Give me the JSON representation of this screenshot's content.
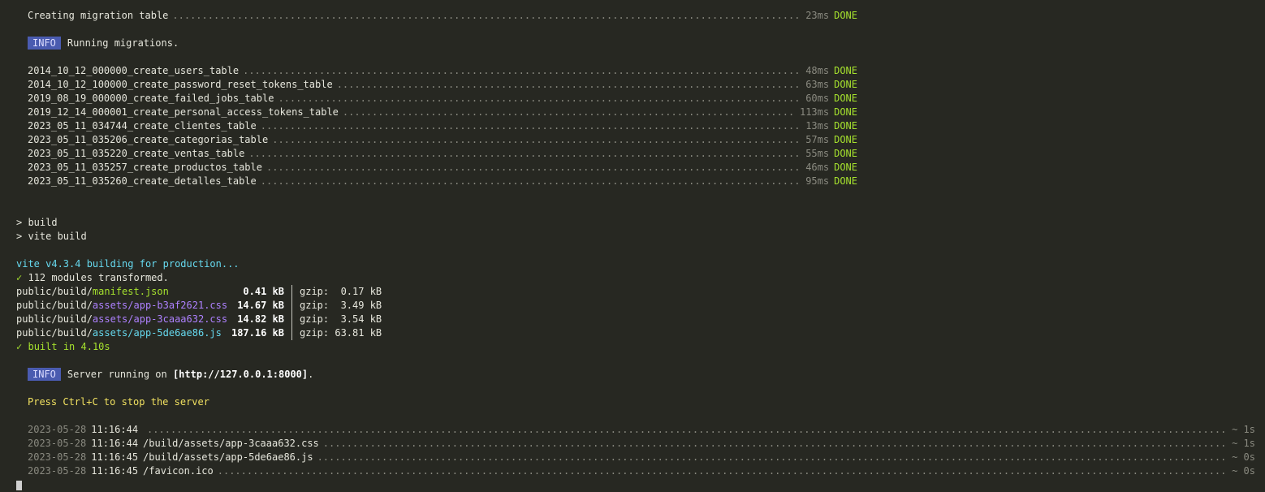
{
  "migration_table": {
    "name": "Creating migration table",
    "time": "23ms",
    "status": "DONE"
  },
  "info1": {
    "badge": "INFO",
    "text": "Running migrations."
  },
  "migrations": [
    {
      "name": "2014_10_12_000000_create_users_table",
      "time": "48ms",
      "status": "DONE"
    },
    {
      "name": "2014_10_12_100000_create_password_reset_tokens_table",
      "time": "63ms",
      "status": "DONE"
    },
    {
      "name": "2019_08_19_000000_create_failed_jobs_table",
      "time": "60ms",
      "status": "DONE"
    },
    {
      "name": "2019_12_14_000001_create_personal_access_tokens_table",
      "time": "113ms",
      "status": "DONE"
    },
    {
      "name": "2023_05_11_034744_create_clientes_table",
      "time": "13ms",
      "status": "DONE"
    },
    {
      "name": "2023_05_11_035206_create_categorias_table",
      "time": "57ms",
      "status": "DONE"
    },
    {
      "name": "2023_05_11_035220_create_ventas_table",
      "time": "55ms",
      "status": "DONE"
    },
    {
      "name": "2023_05_11_035257_create_productos_table",
      "time": "46ms",
      "status": "DONE"
    },
    {
      "name": "2023_05_11_035260_create_detalles_table",
      "time": "95ms",
      "status": "DONE"
    }
  ],
  "npm": {
    "line1": "> build",
    "line2": "> vite build"
  },
  "vite": {
    "building": "vite v4.3.4 building for production...",
    "check": "✓",
    "transformed": "112 modules transformed.",
    "assets": [
      {
        "dir": "public/build/",
        "file": "manifest.json",
        "size": "0.41 kB",
        "gzip": "gzip:  0.17 kB"
      },
      {
        "dir": "public/build/",
        "file": "assets/app-b3af2621.css",
        "size": "14.67 kB",
        "gzip": "gzip:  3.49 kB"
      },
      {
        "dir": "public/build/",
        "file": "assets/app-3caaa632.css",
        "size": "14.82 kB",
        "gzip": "gzip:  3.54 kB"
      },
      {
        "dir": "public/build/",
        "file": "assets/app-5de6ae86.js",
        "size": "187.16 kB",
        "gzip": "gzip: 63.81 kB"
      }
    ],
    "built": "built in 4.10s"
  },
  "info2": {
    "badge": "INFO",
    "text_pre": "Server running on ",
    "url": "[http://127.0.0.1:8000]",
    "text_post": "."
  },
  "stop_hint": "Press Ctrl+C to stop the server",
  "requests": [
    {
      "date": "2023-05-28",
      "time": "11:16:44",
      "path": "",
      "duration": "~ 1s"
    },
    {
      "date": "2023-05-28",
      "time": "11:16:44",
      "path": "/build/assets/app-3caaa632.css",
      "duration": "~ 1s"
    },
    {
      "date": "2023-05-28",
      "time": "11:16:45",
      "path": "/build/assets/app-5de6ae86.js",
      "duration": "~ 0s"
    },
    {
      "date": "2023-05-28",
      "time": "11:16:45",
      "path": "/favicon.ico",
      "duration": "~ 0s"
    }
  ],
  "colors": {
    "background": "#272822",
    "done": "#a6e22e",
    "badge": "#4a5bb0",
    "warning": "#f0e060"
  }
}
